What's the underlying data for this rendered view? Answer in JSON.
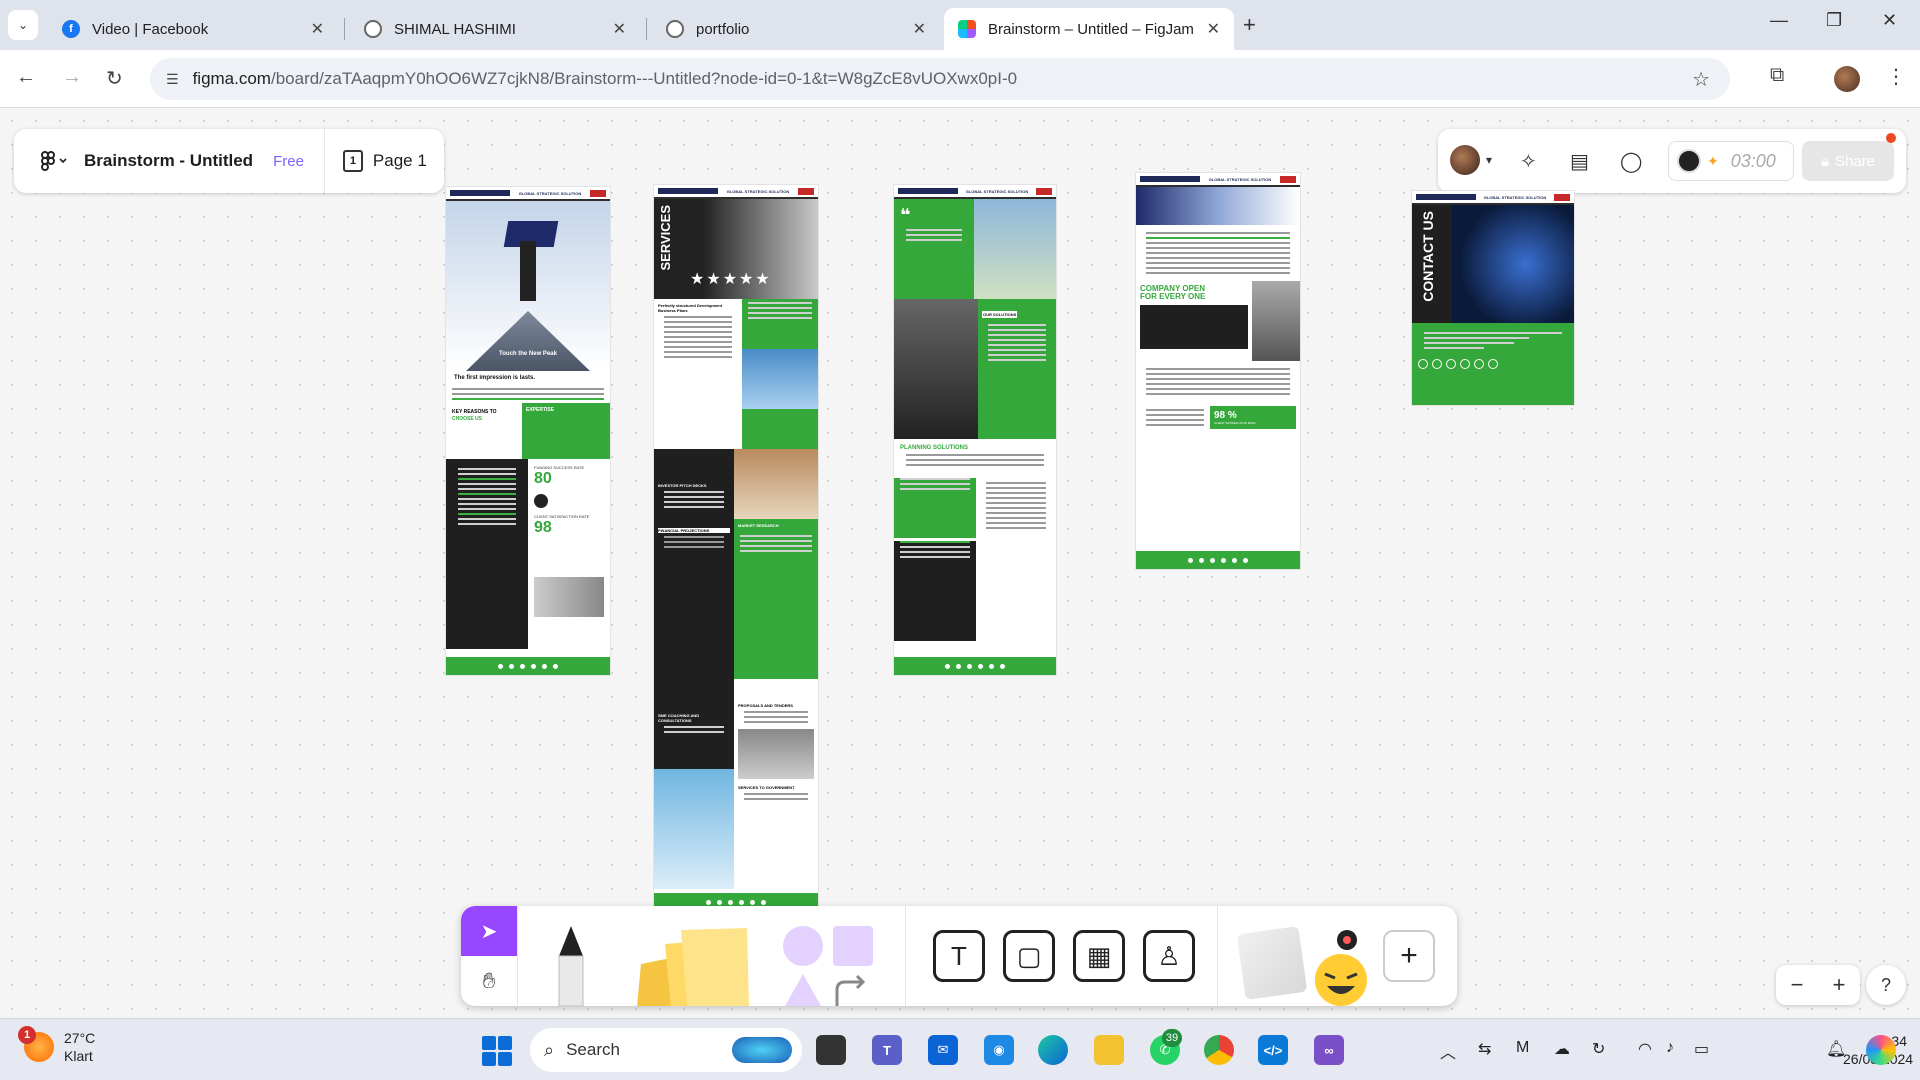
{
  "browser": {
    "tabs": [
      {
        "label": "Video | Facebook",
        "icon": "facebook-icon"
      },
      {
        "label": "SHIMAL HASHIMI",
        "icon": "globe-icon"
      },
      {
        "label": "portfolio",
        "icon": "globe-icon"
      },
      {
        "label": "Brainstorm – Untitled – FigJam",
        "icon": "figjam-icon",
        "active": true
      }
    ],
    "url_host": "figma.com",
    "url_path": "/board/zaTAaqpmY0hOO6WZ7cjkN8/Brainstorm---Untitled?node-id=0-1&t=W8gZcE8vUOXwx0pI-0"
  },
  "figjam": {
    "board_title": "Brainstorm - Untitled",
    "plan_badge": "Free",
    "page_label": "Page 1",
    "page_number_icon": "1",
    "timer": "03:00",
    "share_label": "Share",
    "accent_color": "#9747ff"
  },
  "frames": {
    "frame1": {
      "header": "GLOBAL STRATEGIC SOLUTION",
      "hero_caption": "Touch the New Peak",
      "quote": "The first impression is lasts.",
      "reasons_title": "KEY REASONS TO",
      "reasons_accent": "CHOOSE US",
      "expertise": "EXPERTISE",
      "funding_label": "FUNDING SUCCESS RATE",
      "funding_value": "80",
      "client_label": "CLIENT SATISFACTION RATE",
      "client_value": "98"
    },
    "frame2": {
      "header": "GLOBAL STRATEGIC SOLUTION",
      "services": "SERVICES",
      "s1": "Perfectly structured Development Business Plans",
      "s2": "INVESTOR PITCH DECKS",
      "s3": "MARKET RESEARCH",
      "s4": "FINANCIAL PROJECTIONS",
      "s5": "SME COACHING AND CONSULTATIONS",
      "s6": "PROPOSALS AND TENDERS",
      "s7": "SERVICES TO GOVERNMENT"
    },
    "frame3": {
      "header": "GLOBAL STRATEGIC SOLUTION",
      "our_solutions": "OUR SOLUTIONS",
      "planning": "PLANNING SOLUTIONS"
    },
    "frame4": {
      "header": "GLOBAL STRATEGIC SOLUTION",
      "company_open": "COMPANY OPEN",
      "for_everyone": "FOR EVERY ONE",
      "stat_value": "98 %",
      "stat_label": "CLIENT SATISFACTION RATE"
    },
    "frame5": {
      "header": "GLOBAL STRATEGIC SOLUTION",
      "contact": "CONTACT US"
    }
  },
  "toolbar": {
    "tools": [
      "select",
      "hand",
      "marker",
      "sticky-note",
      "shapes",
      "connector",
      "text",
      "section",
      "table",
      "stamp",
      "widgets",
      "more"
    ]
  },
  "zoom": {
    "minus": "−",
    "plus": "+",
    "help": "?"
  },
  "taskbar": {
    "weather_temp": "27°C",
    "weather_desc": "Klart",
    "weather_badge": "1",
    "search_placeholder": "Search",
    "whatsapp_badge": "39",
    "time": "22:34",
    "date": "26/08/2024"
  }
}
